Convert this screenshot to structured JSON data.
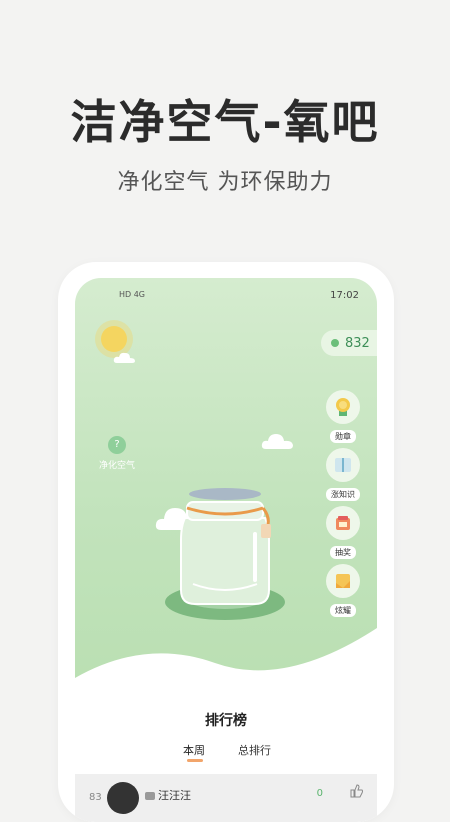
{
  "headline": "洁净空气-氧吧",
  "subheadline": "净化空气 为环保助力",
  "status_bar": {
    "time": "17:02",
    "network": "HD 4G"
  },
  "points": "832",
  "purify_label": "净化空气",
  "side_menu": [
    {
      "label": "勋章",
      "icon": "medal-icon"
    },
    {
      "label": "涨知识",
      "icon": "book-icon"
    },
    {
      "label": "抽奖",
      "icon": "lottery-icon"
    },
    {
      "label": "炫耀",
      "icon": "share-icon"
    }
  ],
  "ranking": {
    "title": "排行榜",
    "tabs": [
      "本周",
      "总排行"
    ],
    "active_tab": "本周",
    "rows": [
      {
        "rank": "83",
        "name": "汪汪汪",
        "score": "0"
      }
    ]
  },
  "colors": {
    "accent": "#f2a56b",
    "green": "#5bb46e",
    "bg": "#f3f3f2"
  }
}
